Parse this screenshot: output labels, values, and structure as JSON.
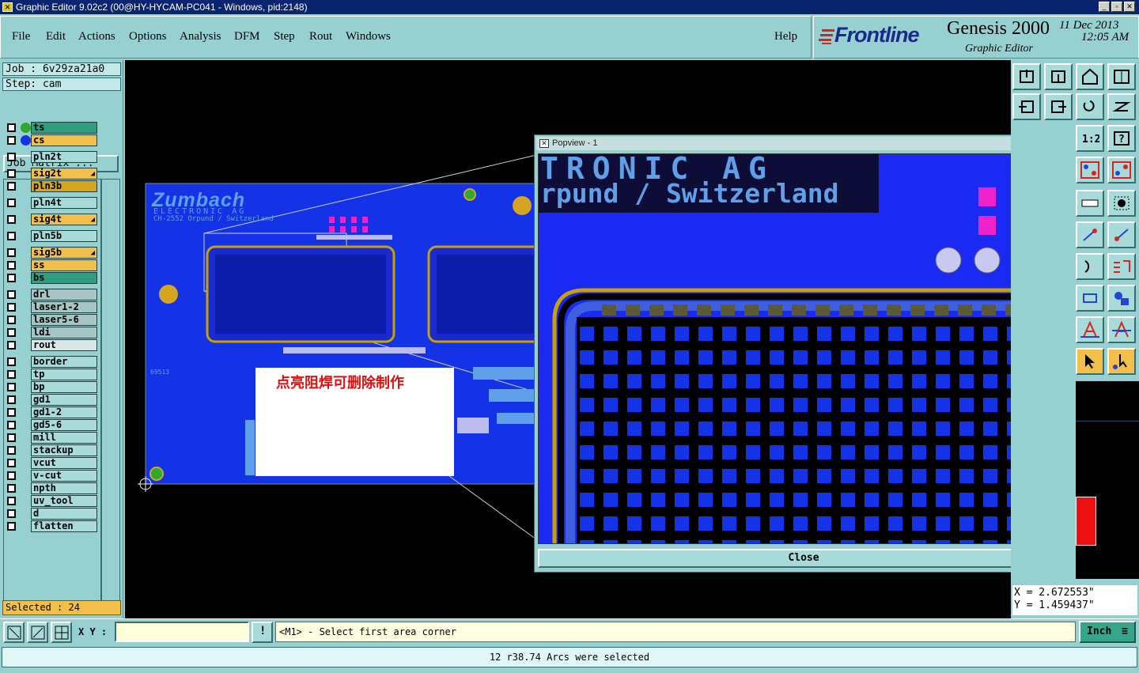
{
  "window": {
    "title": "Graphic Editor 9.02c2 (00@HY-HYCAM-PC041 - Windows, pid:2148)",
    "controls": [
      "minimize-icon",
      "maximize-icon",
      "close-icon"
    ]
  },
  "menu": {
    "file": "File",
    "edit": "Edit",
    "actions": "Actions",
    "options": "Options",
    "analysis": "Analysis",
    "dfm": "DFM",
    "step": "Step",
    "rout": "Rout",
    "windows": "Windows",
    "help": "Help"
  },
  "brand": {
    "logo": "Frontline",
    "product": "Genesis 2000",
    "subtitle": "Graphic Editor",
    "date": "11 Dec 2013",
    "time": "12:05 AM"
  },
  "job": {
    "job_label": "Job : 6v29za21a0",
    "step_label": "Step: cam",
    "matrix_button": "Job Matrix ..."
  },
  "layers": [
    {
      "name": "ts",
      "color": "#2e9e7e",
      "dot": "#2fa82f"
    },
    {
      "name": "cs",
      "color": "#f2c04a",
      "dot": "#1533e6"
    },
    {
      "name": "pln2t",
      "color": "#a8dada"
    },
    {
      "name": "sig2t",
      "color": "#f2c04a",
      "arrow": true
    },
    {
      "name": "pln3b",
      "color": "#d5a520"
    },
    {
      "name": "pln4t",
      "color": "#a8dada"
    },
    {
      "name": "sig4t",
      "color": "#f2c04a",
      "arrow": true
    },
    {
      "name": "pln5b",
      "color": "#a8dada"
    },
    {
      "name": "sig5b",
      "color": "#f2c04a",
      "arrow": true
    },
    {
      "name": "ss",
      "color": "#f2c04a"
    },
    {
      "name": "bs",
      "color": "#2e9e7e"
    },
    {
      "name": "drl",
      "color": "#a8c4c4"
    },
    {
      "name": "laser1-2",
      "color": "#a8c4c4"
    },
    {
      "name": "laser5-6",
      "color": "#a8c4c4"
    },
    {
      "name": "ldi",
      "color": "#a8c4c4"
    },
    {
      "name": "rout",
      "color": "#d8e6e6"
    },
    {
      "name": "border",
      "color": "#a8dada"
    },
    {
      "name": "tp",
      "color": "#a8dada"
    },
    {
      "name": "bp",
      "color": "#a8dada"
    },
    {
      "name": "gd1",
      "color": "#a8dada"
    },
    {
      "name": "gd1-2",
      "color": "#a8dada"
    },
    {
      "name": "gd5-6",
      "color": "#a8dada"
    },
    {
      "name": "mill",
      "color": "#a8dada"
    },
    {
      "name": "stackup",
      "color": "#a8dada"
    },
    {
      "name": "vcut",
      "color": "#a8dada"
    },
    {
      "name": "v-cut",
      "color": "#a8dada"
    },
    {
      "name": "npth",
      "color": "#a8dada"
    },
    {
      "name": "uv_tool",
      "color": "#a8dada"
    },
    {
      "name": "d",
      "color": "#a8dada"
    },
    {
      "name": "flatten",
      "color": "#a8dada"
    }
  ],
  "selected_label": "Selected : 24",
  "canvas": {
    "board_title": "Zumbach",
    "board_sub1": "ELECTRONIC AG",
    "board_sub2": "CH-2552 Orpund / Switzerland",
    "annotation": "点亮阻焊可删除制作",
    "small_code": "69513"
  },
  "popview": {
    "title": "Popview - 1",
    "text_line1": "TRONIC AG",
    "text_line2": "rpund / Switzerland",
    "close_button": "Close"
  },
  "coords": {
    "x": "X = 2.672553\"",
    "y": "Y = 1.459437\""
  },
  "cmdbar": {
    "xy_label": "X Y :",
    "xy_value": "",
    "prompt": "<M1> - Select first area corner",
    "units": "Inch"
  },
  "status": "12 r38.74 Arcs were selected",
  "colors": {
    "board": "#1533e6",
    "gold": "#d5a520",
    "pad": "#ee22cc",
    "accent": "#97d0d0"
  }
}
